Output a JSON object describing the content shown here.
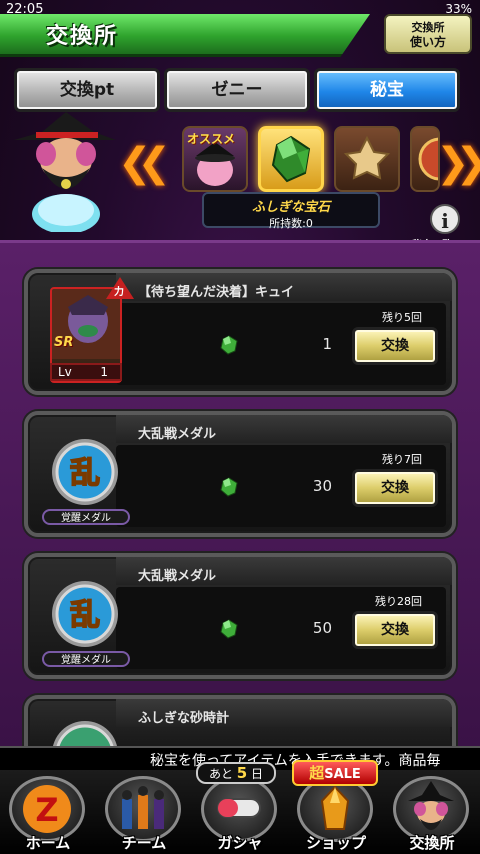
{
  "status_bar": {
    "time": "22:05",
    "right": "33%"
  },
  "header": {
    "title": "交換所",
    "help_line1": "交換所",
    "help_line2": "使い方"
  },
  "tabs": [
    {
      "label": "交換pt",
      "active": false
    },
    {
      "label": "ゼニー",
      "active": false
    },
    {
      "label": "秘宝",
      "active": true
    }
  ],
  "carousel": {
    "recommend_label": "オススメ",
    "selected_item": {
      "name": "ふしぎな宝石",
      "owned": "所持数:0"
    },
    "info_label": "秘宝一覧"
  },
  "rewards": [
    {
      "title": "【待ち望んだ決着】キュイ",
      "type_badge": "力",
      "rarity": "SR",
      "level_label": "Lv",
      "level": "1",
      "cost": "1",
      "remaining": "残り5回",
      "button": "交換"
    },
    {
      "title": "大乱戦メダル",
      "medal_char": "乱",
      "medal_label": "覚醒メダル",
      "cost": "30",
      "remaining": "残り7回",
      "button": "交換"
    },
    {
      "title": "大乱戦メダル",
      "medal_char": "乱",
      "medal_label": "覚醒メダル",
      "cost": "50",
      "remaining": "残り28回",
      "button": "交換"
    },
    {
      "title": "ふしぎな砂時計"
    }
  ],
  "ticker": "秘宝を使ってアイテムを入手できます。商品毎",
  "gacha_badge": {
    "prefix": "あと",
    "days": "5",
    "suffix": "日"
  },
  "sale_badge": {
    "super": "超",
    "label": "SALE"
  },
  "nav": [
    {
      "label": "ホーム",
      "icon": "dragonball-z-icon"
    },
    {
      "label": "チーム",
      "icon": "team-icon"
    },
    {
      "label": "ガシャ",
      "icon": "gacha-capsule-icon"
    },
    {
      "label": "ショップ",
      "icon": "shop-crystal-icon"
    },
    {
      "label": "交換所",
      "icon": "exchange-merchant-icon"
    }
  ],
  "colors": {
    "accent_blue": "#1f86e8",
    "header_green": "#2fa32d",
    "gem_green": "#3fae3a",
    "panel_purple": "#5a2068"
  }
}
